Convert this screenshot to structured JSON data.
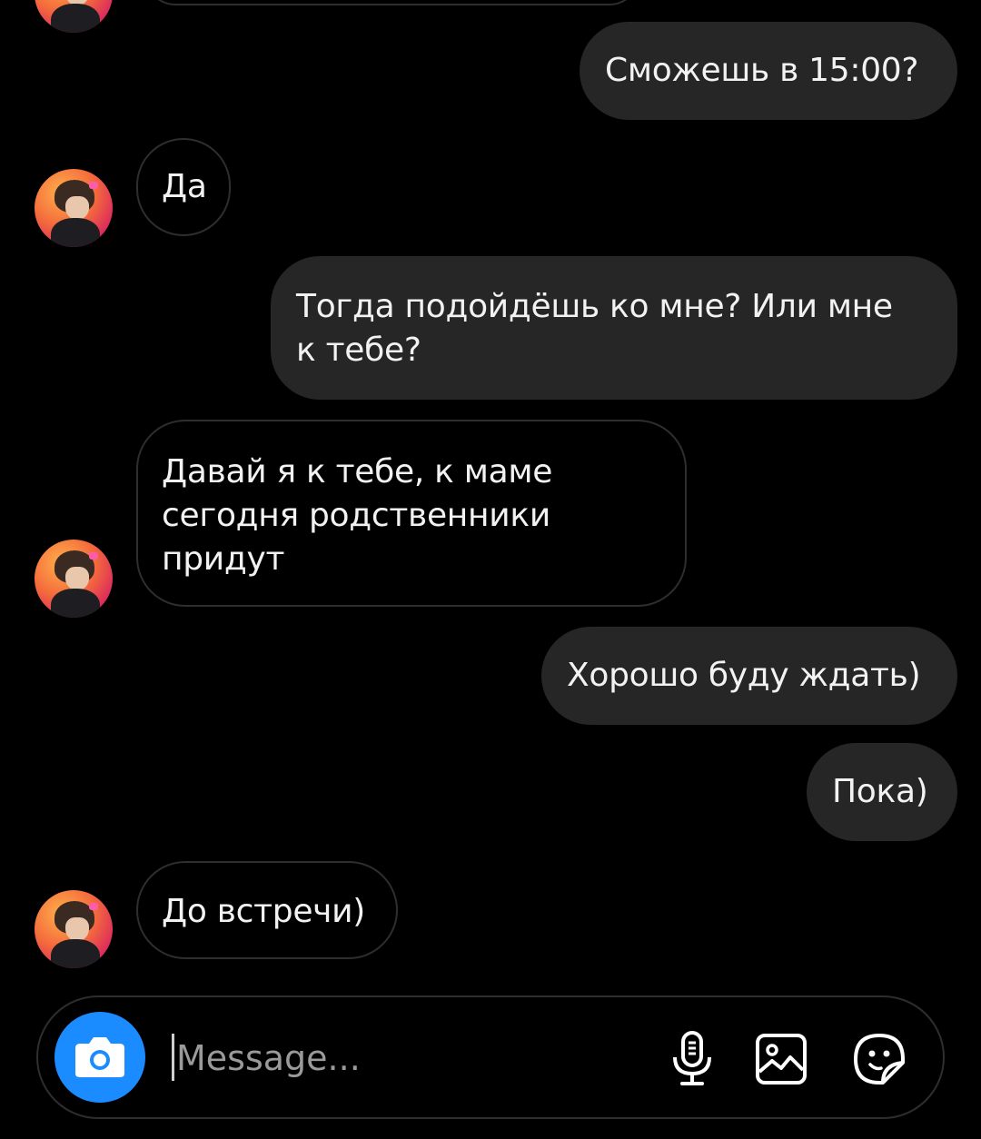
{
  "conversation": {
    "messages": [
      {
        "direction": "out",
        "text": "Сможешь в 15:00?"
      },
      {
        "direction": "in",
        "text": "Да"
      },
      {
        "direction": "out",
        "text": "Тогда подойдёшь ко мне? Или мне\nк тебе?"
      },
      {
        "direction": "in",
        "text": "Давай я к тебе, к маме\nсегодня родственники\nпридут"
      },
      {
        "direction": "out",
        "text": "Хорошо буду ждать)"
      },
      {
        "direction": "out",
        "text": "Пока)"
      },
      {
        "direction": "in",
        "text": "До встречи)"
      }
    ]
  },
  "composer": {
    "placeholder": "Message...",
    "value": "",
    "icons": {
      "camera": "camera-icon",
      "mic": "microphone-icon",
      "gallery": "gallery-icon",
      "sticker": "sticker-icon"
    }
  },
  "colors": {
    "background": "#000000",
    "outgoing_bubble": "#262626",
    "incoming_border": "#2e2e2e",
    "camera_button": "#1a8cff",
    "text": "#f2f2f2"
  }
}
